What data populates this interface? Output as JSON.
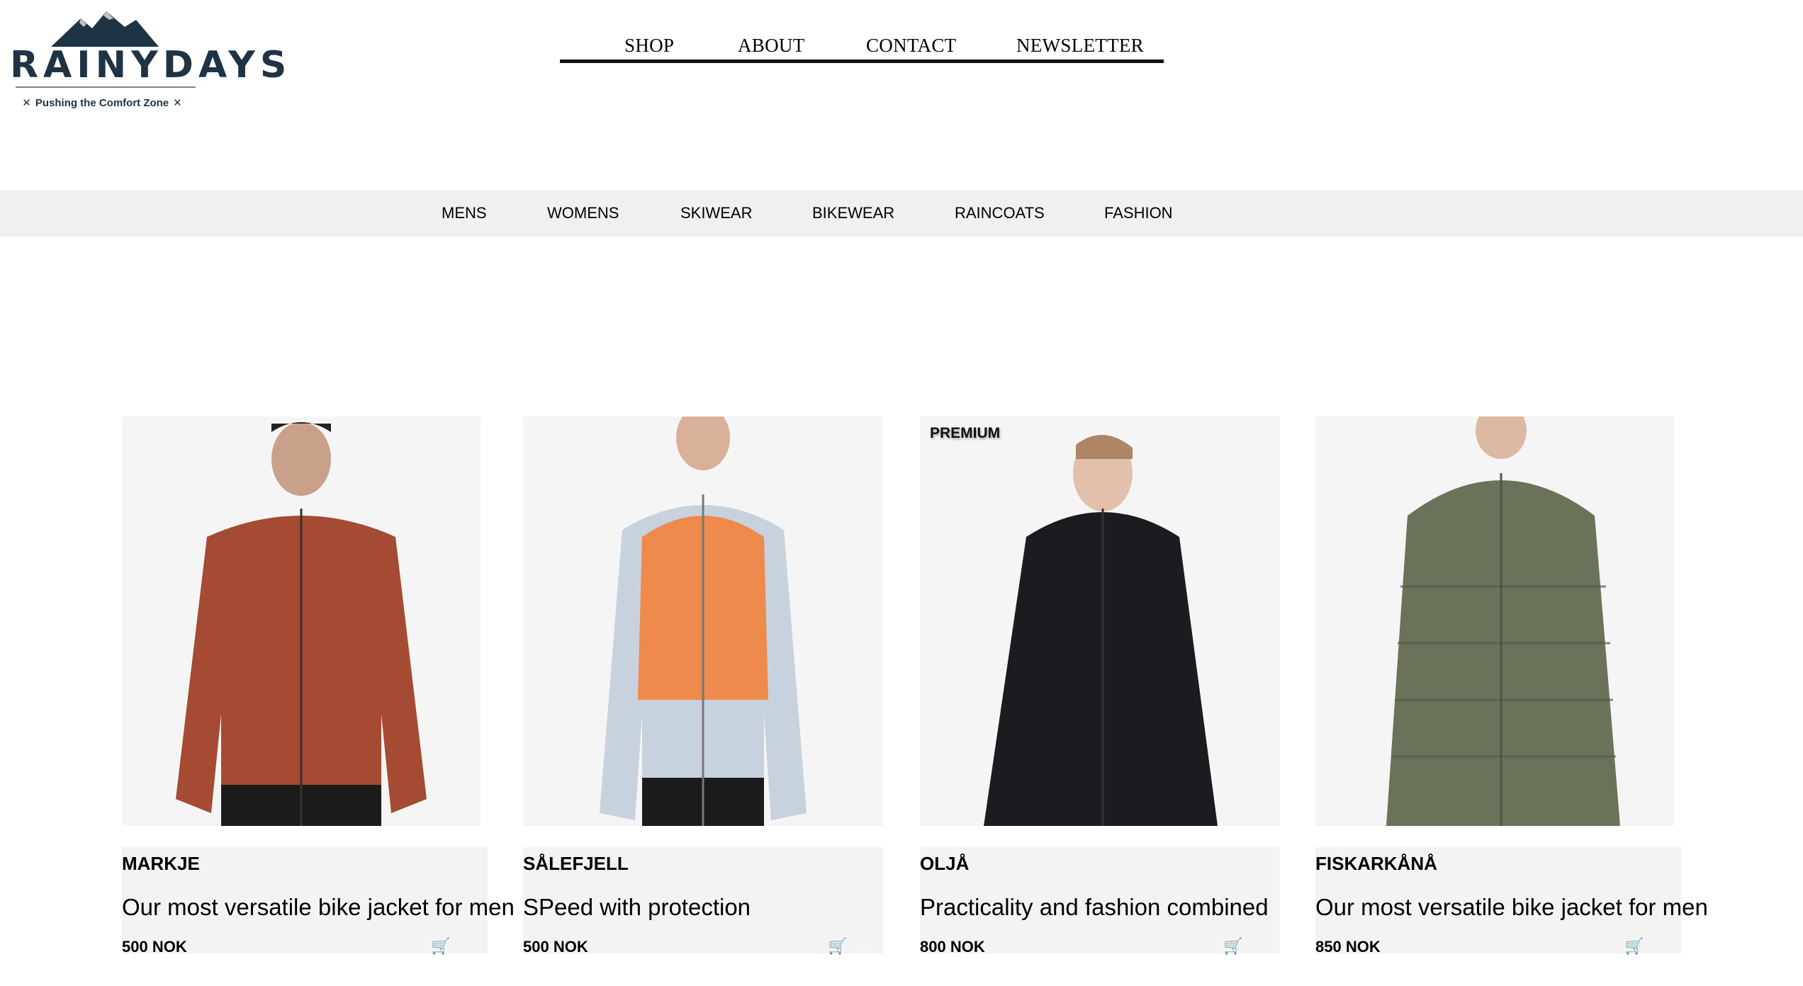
{
  "brand": {
    "name": "RAINYDAYS",
    "tagline": "Pushing the Comfort Zone"
  },
  "topnav": {
    "items": [
      "SHOP",
      "ABOUT",
      "CONTACT",
      "NEWSLETTER"
    ]
  },
  "categories": [
    "MENS",
    "WOMENS",
    "SKIWEAR",
    "BIKEWEAR",
    "RAINCOATS",
    "FASHION"
  ],
  "products": [
    {
      "name": "MARKJE",
      "description": "Our most versatile bike jacket for men",
      "price": "500 NOK",
      "jacket_color": "#a54a33",
      "badge": ""
    },
    {
      "name": "SÅLEFJELL",
      "description": "SPeed with protection",
      "price": "500 NOK",
      "jacket_color": "#ee8a4c",
      "badge": ""
    },
    {
      "name": "OLJÅ",
      "description": "Practicality and fashion combined",
      "price": "800 NOK",
      "jacket_color": "#1b1c20",
      "badge": "PREMIUM"
    },
    {
      "name": "FISKARKÅNÅ",
      "description": "Our most versatile bike jacket for men",
      "price": "850 NOK",
      "jacket_color": "#6a7359",
      "badge": ""
    }
  ],
  "icons": {
    "cart": "cart-icon",
    "wishlist": "heart-icon"
  }
}
